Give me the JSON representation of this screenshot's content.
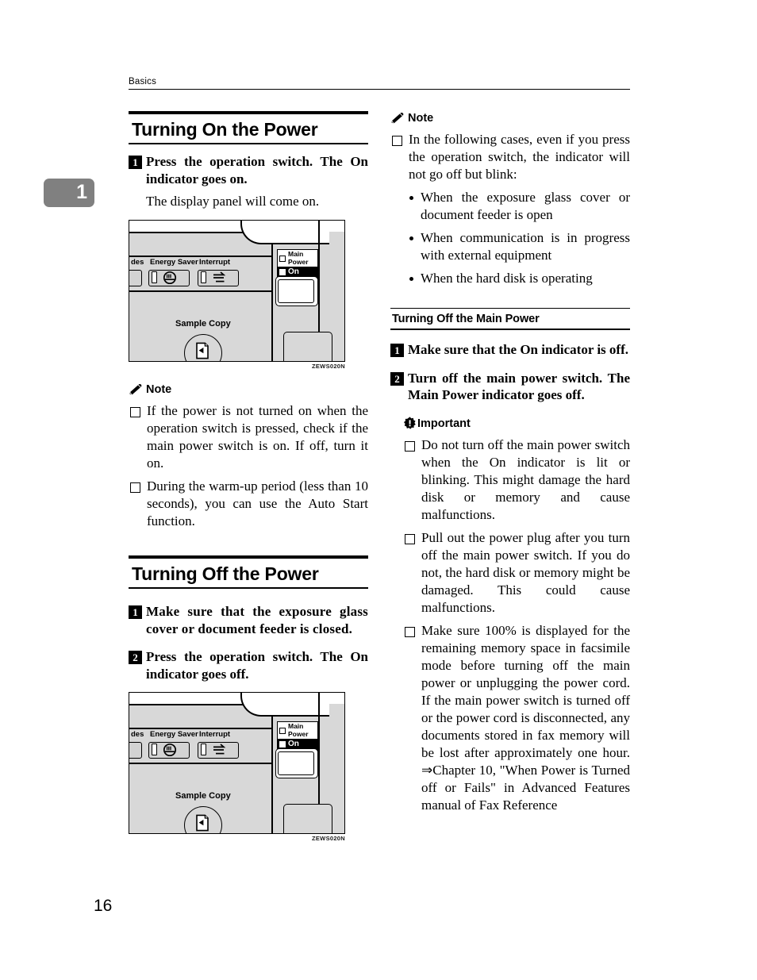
{
  "running_head": {
    "text": "Basics"
  },
  "chapter_tab": {
    "number": "1"
  },
  "folio": {
    "page_number": "16"
  },
  "left_column": {
    "heading1": "Turning On the Power",
    "step1": {
      "number": "1",
      "text": "Press the operation switch. The On indicator goes on.",
      "sub_text": "The display panel will come on."
    },
    "figure1": {
      "caption": "ZEWS020N",
      "panel": {
        "modes_label": "des",
        "energy_saver_label": "Energy Saver",
        "interrupt_label": "Interrupt",
        "sample_copy_label": "Sample Copy",
        "main_power_label_line1": "Main",
        "main_power_label_line2": "Power",
        "on_label": "On"
      }
    },
    "note": {
      "title": "Note",
      "icon": "pencil-icon",
      "items": [
        "If the power is not turned on when the operation switch is pressed, check if the main power switch is on. If off, turn it on.",
        "During the warm-up period (less than 10 seconds), you can use the Auto Start function."
      ]
    },
    "heading2": "Turning Off the Power",
    "step2": {
      "number": "1",
      "text": "Make sure that the exposure glass cover or document feeder is closed."
    },
    "step3": {
      "number": "2",
      "text": "Press the operation switch. The On indicator goes off."
    },
    "figure2": {
      "caption": "ZEWS020N",
      "panel": {
        "modes_label": "des",
        "energy_saver_label": "Energy Saver",
        "interrupt_label": "Interrupt",
        "sample_copy_label": "Sample Copy",
        "main_power_label_line1": "Main",
        "main_power_label_line2": "Power",
        "on_label": "On"
      }
    }
  },
  "right_column": {
    "note": {
      "title": "Note",
      "icon": "pencil-icon",
      "item_intro": "In the following cases, even if you press the operation switch, the indicator will not go off but blink:",
      "bullets": [
        "When the exposure glass cover or document feeder is open",
        "When communication is in progress with external equipment",
        "When the hard disk is operating"
      ]
    },
    "subheading": "Turning Off the Main Power",
    "step1": {
      "number": "1",
      "text": "Make sure that the On indicator is off."
    },
    "step2": {
      "number": "2",
      "text": "Turn off the main power switch. The Main Power indicator goes off."
    },
    "important": {
      "title": "Important",
      "icon": "exclamation-burst-icon",
      "items": [
        "Do not turn off the main power switch when the On indicator is lit or blinking. This might damage the hard disk or memory and cause malfunctions.",
        "Pull out the power plug after you turn off the main power switch. If you do not, the hard disk or memory might be damaged. This could cause malfunctions.",
        "Make sure 100% is displayed for the remaining memory space in facsimile mode before turning off the main power or unplugging the power cord. If the main power switch is turned off or the power cord is disconnected, any documents stored in fax memory will be lost after approximately one hour. ⇒Chapter 10, \"When Power is Turned off or Fails\" in Advanced Features manual of Fax Reference"
      ]
    }
  }
}
